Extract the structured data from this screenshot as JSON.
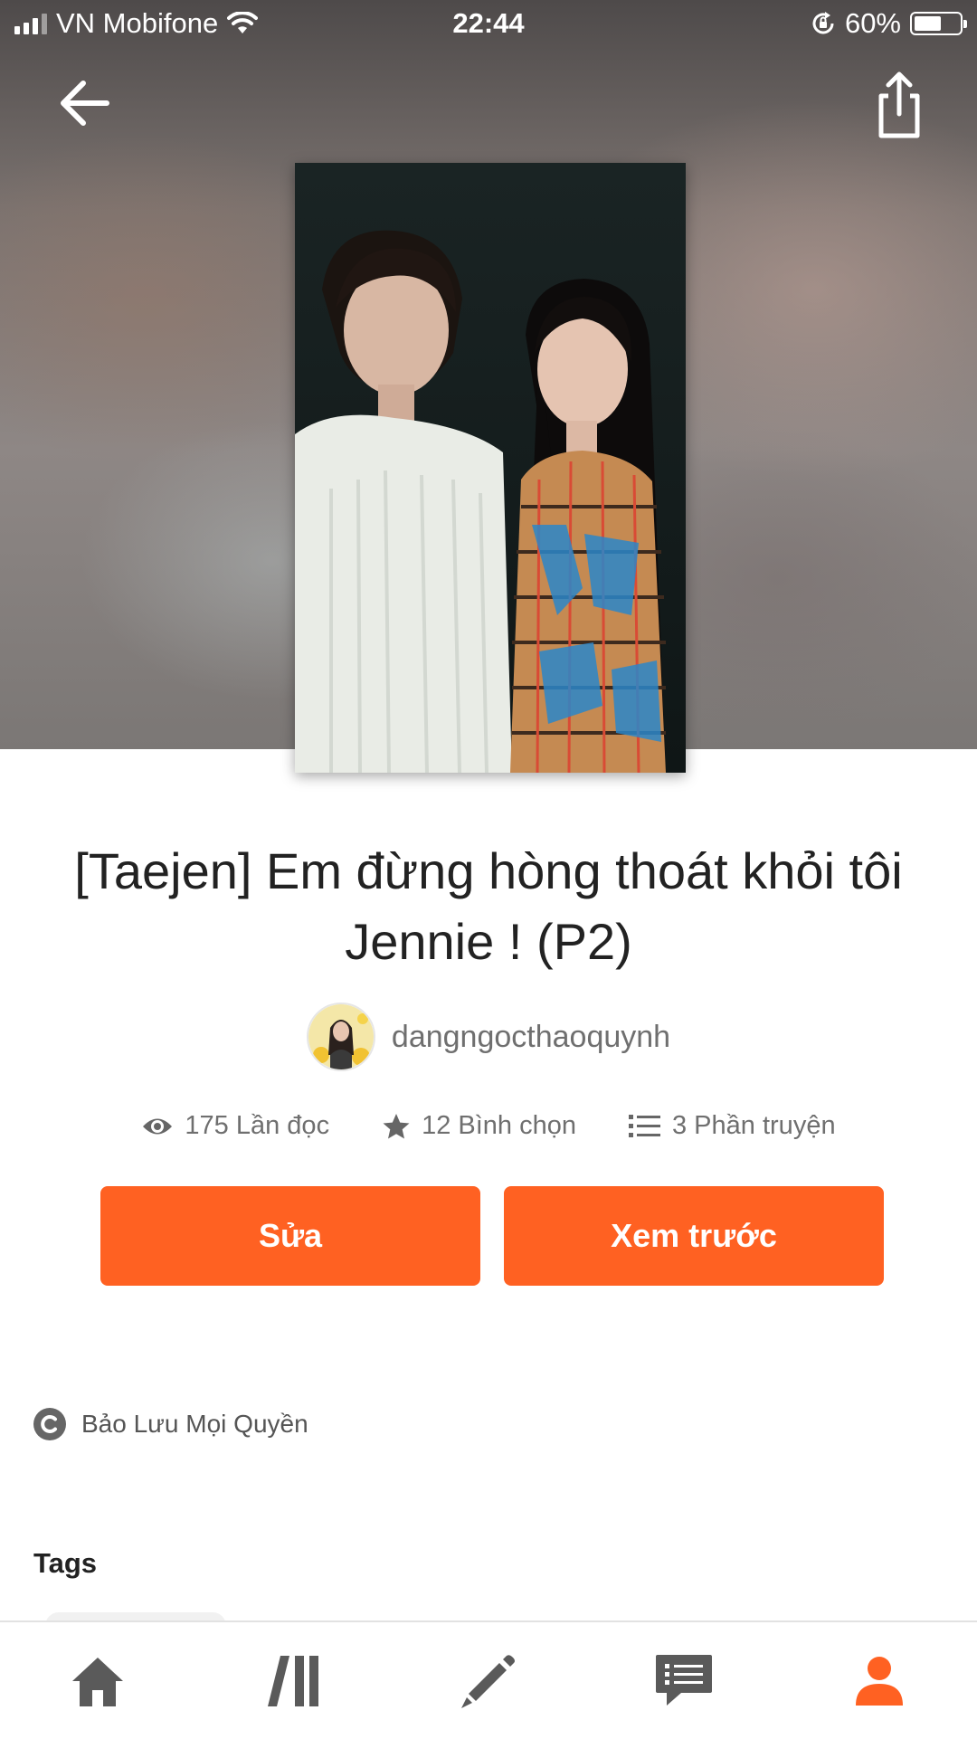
{
  "status_bar": {
    "carrier": "VN Mobifone",
    "time": "22:44",
    "battery_text": "60%",
    "battery_level": 0.6
  },
  "header": {
    "back_icon": "arrow-left-icon",
    "share_icon": "share-icon"
  },
  "story": {
    "title": "[Taejen] Em đừng hòng thoát khỏi tôi Jennie ! (P2)",
    "author": "dangngocthaoquynh",
    "stats": {
      "reads": "175 Lần đọc",
      "votes": "12 Bình chọn",
      "parts": "3 Phần truyện"
    }
  },
  "actions": {
    "edit_label": "Sửa",
    "preview_label": "Xem trước"
  },
  "copyright": {
    "label": "Bảo Lưu Mọi Quyền"
  },
  "tags": {
    "heading": "Tags"
  },
  "bottom_nav": {
    "items": [
      "home-icon",
      "library-icon",
      "write-icon",
      "messages-icon",
      "profile-icon"
    ],
    "active_color": "#ff6122",
    "inactive_color": "#5a5a5a"
  },
  "colors": {
    "accent": "#ff6122"
  }
}
